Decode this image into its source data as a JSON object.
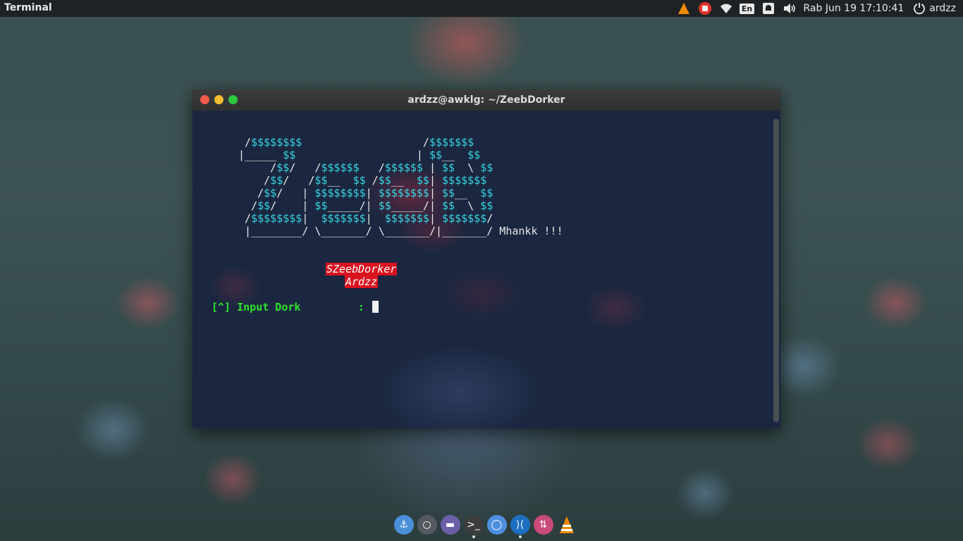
{
  "topbar": {
    "app_title": "Terminal",
    "keyboard_layout": "En",
    "clock": "Rab Jun 19 17:10:41",
    "user": "ardzz",
    "tray_icons": [
      "vlc-icon",
      "stop-record-icon",
      "wifi-icon",
      "keyboard-layout-icon",
      "notification-icon",
      "volume-icon",
      "power-icon"
    ]
  },
  "terminal": {
    "title": "ardzz@awklg: ~/ZeebDorker",
    "ascii_lines": [
      [
        {
          "t": "  /",
          "c": "w"
        },
        {
          "t": "$$$$$$$$",
          "c": "c"
        },
        {
          "t": "                   /",
          "c": "w"
        },
        {
          "t": "$$$$$$$",
          "c": "c"
        }
      ],
      [
        {
          "t": " |_____ ",
          "c": "w"
        },
        {
          "t": "$$",
          "c": "c"
        },
        {
          "t": "                   | ",
          "c": "w"
        },
        {
          "t": "$$",
          "c": "c"
        },
        {
          "t": "__  ",
          "c": "w"
        },
        {
          "t": "$$",
          "c": "c"
        }
      ],
      [
        {
          "t": "      /",
          "c": "w"
        },
        {
          "t": "$$",
          "c": "c"
        },
        {
          "t": "/   /",
          "c": "w"
        },
        {
          "t": "$$$$$$",
          "c": "c"
        },
        {
          "t": "   /",
          "c": "w"
        },
        {
          "t": "$$$$$$",
          "c": "c"
        },
        {
          "t": " | ",
          "c": "w"
        },
        {
          "t": "$$",
          "c": "c"
        },
        {
          "t": "  \\ ",
          "c": "w"
        },
        {
          "t": "$$",
          "c": "c"
        }
      ],
      [
        {
          "t": "     /",
          "c": "w"
        },
        {
          "t": "$$",
          "c": "c"
        },
        {
          "t": "/   /",
          "c": "w"
        },
        {
          "t": "$$",
          "c": "c"
        },
        {
          "t": "__  ",
          "c": "w"
        },
        {
          "t": "$$",
          "c": "c"
        },
        {
          "t": " /",
          "c": "w"
        },
        {
          "t": "$$",
          "c": "c"
        },
        {
          "t": "__  ",
          "c": "w"
        },
        {
          "t": "$$",
          "c": "c"
        },
        {
          "t": "| ",
          "c": "w"
        },
        {
          "t": "$$$$$$$",
          "c": "c"
        }
      ],
      [
        {
          "t": "    /",
          "c": "w"
        },
        {
          "t": "$$",
          "c": "c"
        },
        {
          "t": "/   | ",
          "c": "w"
        },
        {
          "t": "$$$$$$$$",
          "c": "c"
        },
        {
          "t": "| ",
          "c": "w"
        },
        {
          "t": "$$$$$$$$",
          "c": "c"
        },
        {
          "t": "| ",
          "c": "w"
        },
        {
          "t": "$$",
          "c": "c"
        },
        {
          "t": "__  ",
          "c": "w"
        },
        {
          "t": "$$",
          "c": "c"
        }
      ],
      [
        {
          "t": "   /",
          "c": "w"
        },
        {
          "t": "$$",
          "c": "c"
        },
        {
          "t": "/    | ",
          "c": "w"
        },
        {
          "t": "$$",
          "c": "c"
        },
        {
          "t": "_____/| ",
          "c": "w"
        },
        {
          "t": "$$",
          "c": "c"
        },
        {
          "t": "_____/| ",
          "c": "w"
        },
        {
          "t": "$$",
          "c": "c"
        },
        {
          "t": "  \\ ",
          "c": "w"
        },
        {
          "t": "$$",
          "c": "c"
        }
      ],
      [
        {
          "t": "  /",
          "c": "w"
        },
        {
          "t": "$$$$$$$$",
          "c": "c"
        },
        {
          "t": "|  ",
          "c": "w"
        },
        {
          "t": "$$$$$$$",
          "c": "c"
        },
        {
          "t": "|  ",
          "c": "w"
        },
        {
          "t": "$$$$$$$",
          "c": "c"
        },
        {
          "t": "| ",
          "c": "w"
        },
        {
          "t": "$$$$$$$",
          "c": "c"
        },
        {
          "t": "/",
          "c": "w"
        }
      ],
      [
        {
          "t": "  |________/ \\_______/ \\_______/|_______/ Mhankk !!!",
          "c": "w"
        }
      ]
    ],
    "tag_name": "SZeebDorker",
    "tag_author": "Ardzz",
    "prompt": "[^] Input Dork         : "
  },
  "dock": {
    "items": [
      {
        "name": "anchor-app-icon",
        "label": "⚓",
        "color": "#4a90d9",
        "running": false
      },
      {
        "name": "circle-app-icon",
        "label": "○",
        "color": "#555a60",
        "running": false
      },
      {
        "name": "files-app-icon",
        "label": "▬",
        "color": "#6b5fa8",
        "running": false
      },
      {
        "name": "terminal-app-icon",
        "label": ">_",
        "color": "#3c3c3c",
        "running": true
      },
      {
        "name": "chromium-app-icon",
        "label": "◯",
        "color": "#4e8fe0",
        "running": false
      },
      {
        "name": "vscode-app-icon",
        "label": "⟩⟨",
        "color": "#1e6fc2",
        "running": true
      },
      {
        "name": "transfer-app-icon",
        "label": "⇅",
        "color": "#c84b7a",
        "running": false
      },
      {
        "name": "vlc-dock-icon",
        "label": "",
        "color": "transparent",
        "running": false
      }
    ]
  }
}
